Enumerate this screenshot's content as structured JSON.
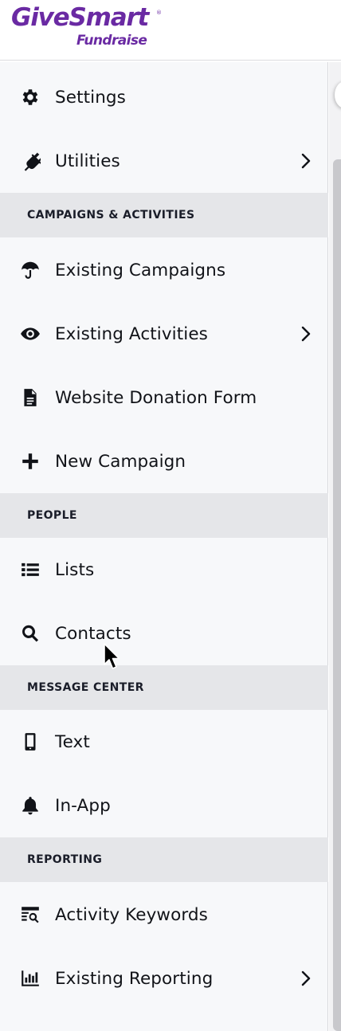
{
  "brand": {
    "name": "GiveSmart",
    "registered": "®",
    "product": "Fundraise",
    "color": "#6a2aa3"
  },
  "nav": {
    "settings": {
      "label": "Settings",
      "icon": "gear-icon"
    },
    "utilities": {
      "label": "Utilities",
      "icon": "plug-icon",
      "has_submenu": true
    },
    "campaigns_section": "CAMPAIGNS & ACTIVITIES",
    "existing_campaigns": {
      "label": "Existing Campaigns",
      "icon": "umbrella-icon"
    },
    "existing_activities": {
      "label": "Existing Activities",
      "icon": "eye-icon",
      "has_submenu": true
    },
    "website_donation_form": {
      "label": "Website Donation Form",
      "icon": "document-icon"
    },
    "new_campaign": {
      "label": "New Campaign",
      "icon": "plus-icon"
    },
    "people_section": "PEOPLE",
    "lists": {
      "label": "Lists",
      "icon": "list-icon"
    },
    "contacts": {
      "label": "Contacts",
      "icon": "search-icon"
    },
    "message_section": "MESSAGE CENTER",
    "text": {
      "label": "Text",
      "icon": "mobile-phone-icon"
    },
    "in_app": {
      "label": "In-App",
      "icon": "bell-icon"
    },
    "reporting_section": "REPORTING",
    "activity_keywords": {
      "label": "Activity Keywords",
      "icon": "keyword-report-icon"
    },
    "existing_reporting": {
      "label": "Existing Reporting",
      "icon": "bar-chart-icon",
      "has_submenu": true
    }
  }
}
